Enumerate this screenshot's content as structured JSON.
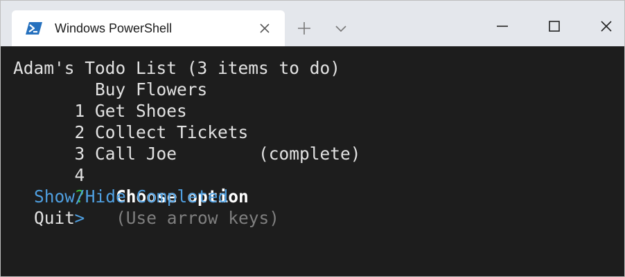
{
  "window": {
    "tab_title": "Windows PowerShell",
    "icon": "powershell-icon",
    "accent": "#2671be"
  },
  "terminal": {
    "header": "Adam's Todo List (3 items to do)",
    "items": [
      {
        "num": "1",
        "text": "Buy Flowers",
        "status": ""
      },
      {
        "num": "2",
        "text": "Get Shoes",
        "status": ""
      },
      {
        "num": "3",
        "text": "Collect Tickets",
        "status": ""
      },
      {
        "num": "4",
        "text": "Call Joe",
        "status": "(complete)"
      }
    ],
    "prompt": {
      "marker": "?",
      "question": "Choose option",
      "hint": "(Use arrow keys)"
    },
    "menu": {
      "pointer": ">",
      "options": [
        "Show/Hide Completed",
        "Quit"
      ]
    },
    "colors": {
      "background": "#1d1d1d",
      "text": "#e2e2e2",
      "question_mark": "#3fbf3f",
      "hint": "#7f7f7f",
      "selected": "#4f9fe0"
    }
  }
}
